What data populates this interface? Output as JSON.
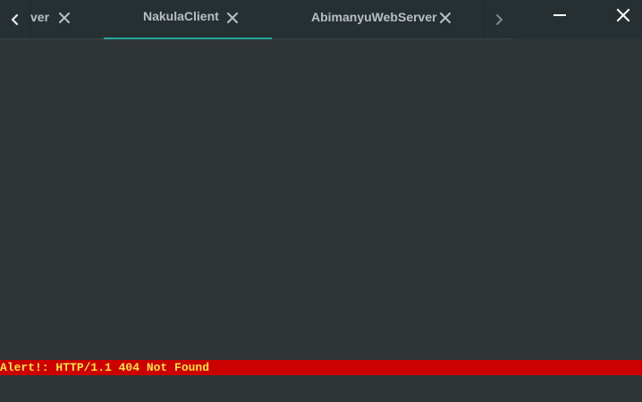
{
  "tabs": [
    {
      "label": "ver",
      "active": false
    },
    {
      "label": "NakulaClient",
      "active": true
    },
    {
      "label": "AbimanyuWebServer",
      "active": false
    }
  ],
  "icons": {
    "scroll_left": "chevron-left-icon",
    "scroll_right": "chevron-right-icon",
    "tab_close": "close-icon",
    "minimize": "minimize-icon",
    "window_close": "close-icon"
  },
  "colors": {
    "accent": "#26a69a",
    "alert_bg": "#cc0000",
    "alert_text": "#f7e04a",
    "background": "#2f3437"
  },
  "terminal": {
    "alert": "Alert!: HTTP/1.1 404 Not Found"
  }
}
